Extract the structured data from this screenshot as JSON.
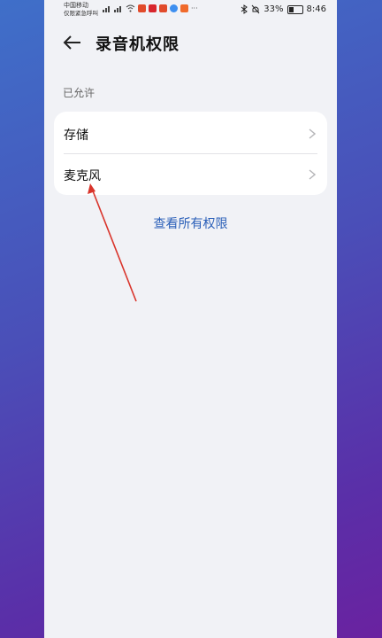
{
  "statusbar": {
    "carrier_line1": "中国移动",
    "carrier_line2": "仅限紧急呼叫",
    "battery_text": "33%",
    "battery_level": 0.33,
    "time": "8:46"
  },
  "header": {
    "title": "录音机权限"
  },
  "section": {
    "label": "已允许"
  },
  "permissions": [
    {
      "label": "存储"
    },
    {
      "label": "麦克风"
    }
  ],
  "view_all": {
    "label": "查看所有权限"
  },
  "colors": {
    "link": "#2a5fb8",
    "annotation_arrow": "#d9342b"
  }
}
